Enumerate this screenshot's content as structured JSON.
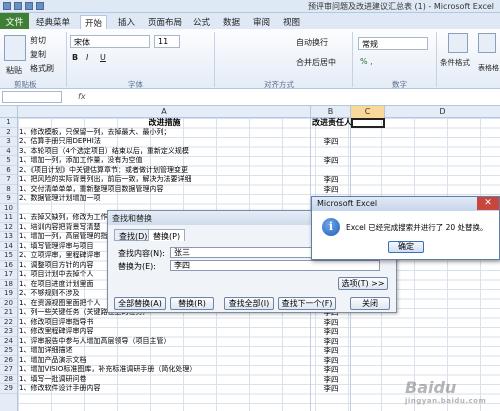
{
  "window": {
    "title": "预评审问题及改进建议汇总表 (1) - Microsoft Excel"
  },
  "menu": {
    "file": "文件",
    "tabs": [
      "经典菜单",
      "开始",
      "插入",
      "页面布局",
      "公式",
      "数据",
      "审阅",
      "视图"
    ],
    "active_index": 1
  },
  "ribbon": {
    "cut": "剪切",
    "copy": "复制",
    "format_painter": "格式刷",
    "paste": "粘贴",
    "font_name": "宋体",
    "font_size": "11",
    "wrap": "自动换行",
    "merge": "合并后居中",
    "number_format": "常规",
    "cond_format": "条件格式",
    "table_format": "套用\n表格格式",
    "group_clipboard": "剪贴板",
    "group_font": "字体",
    "group_align": "对齐方式",
    "group_number": "数字"
  },
  "formula_bar": {
    "fx": "fx"
  },
  "columns": [
    "A",
    "B",
    "C",
    "D"
  ],
  "sheet": {
    "header": {
      "a": "改进措施",
      "b": "改进责任人"
    },
    "rows": [
      {
        "a": "1、修改模板，只保留一列，去掉最大、最小列；",
        "b": ""
      },
      {
        "a": "2、估算手册只用DEPHI法",
        "b": "李四"
      },
      {
        "a": "3、本轮项目（4个选定项目）结束以后，重新定义规模",
        "b": ""
      },
      {
        "a": "1、增加一列，添加工作量，没有为空值",
        "b": "李四"
      },
      {
        "a": "2、《项目计划》中关键估算章节：或者做计划管理变更",
        "b": ""
      },
      {
        "a": "1、把风险的实际背景列出，前后一致，解决为法要详细",
        "b": "李四"
      },
      {
        "a": "1、交付清单单单，重新整理项目数据管理内容",
        "b": "李四"
      },
      {
        "a": "2、数据管理计划增加一项",
        "b": ""
      },
      {
        "a": "",
        "b": ""
      },
      {
        "a": "1、去掉又缺列，修改为工作量",
        "b": "李四"
      },
      {
        "a": "1、培训内容把背景写清楚",
        "b": "李四"
      },
      {
        "a": "1、增加一列，高层管理的指导",
        "b": "李四"
      },
      {
        "a": "1、填写管理评审与项目",
        "b": "李四"
      },
      {
        "a": "2、立项评审，里程碑评审",
        "b": ""
      },
      {
        "a": "1、调整项目方针的内容",
        "b": "李四"
      },
      {
        "a": "1、项目计划中去掉个人",
        "b": "李四"
      },
      {
        "a": "1、在项目进度计划里面",
        "b": "李四"
      },
      {
        "a": "2、不够规则不涉及",
        "b": ""
      },
      {
        "a": "1、在资源视图里面把个人",
        "b": "李四"
      },
      {
        "a": "1、列一些关键任务（关键路径上的任务）",
        "b": "李四"
      },
      {
        "a": "1、修改项目评审指导书",
        "b": "李四"
      },
      {
        "a": "1、修改里程碑评审内容",
        "b": "李四"
      },
      {
        "a": "1、评审报告中参与人增加高层领导（项目主管）",
        "b": "李四"
      },
      {
        "a": "1、增加详细描述",
        "b": "李四"
      },
      {
        "a": "1、增加产品演示文档",
        "b": "李四"
      },
      {
        "a": "1、增加VISIO标准图库，补充标准调研手册（简化处理）",
        "b": "李四"
      },
      {
        "a": "1、填写一批调研问卷",
        "b": "李四"
      },
      {
        "a": "1、修改软件设计手册内容",
        "b": "李四"
      }
    ]
  },
  "find_replace": {
    "title": "查找和替换",
    "tab_find": "查找(D)",
    "tab_replace": "替换(P)",
    "find_label": "查找内容(N):",
    "find_value": "张三",
    "replace_label": "替换为(E):",
    "replace_value": "李四",
    "options": "选项(T) >>",
    "replace_all": "全部替换(A)",
    "replace": "替换(R)",
    "find_all": "查找全部(I)",
    "find_next": "查找下一个(F)",
    "close": "关闭"
  },
  "msgbox": {
    "title": "Microsoft Excel",
    "text": "Excel 已经完成搜索并进行了 20 处替换。",
    "ok": "确定"
  },
  "watermark": {
    "text": "Baidu",
    "sub": "jingyan.baidu.com"
  }
}
